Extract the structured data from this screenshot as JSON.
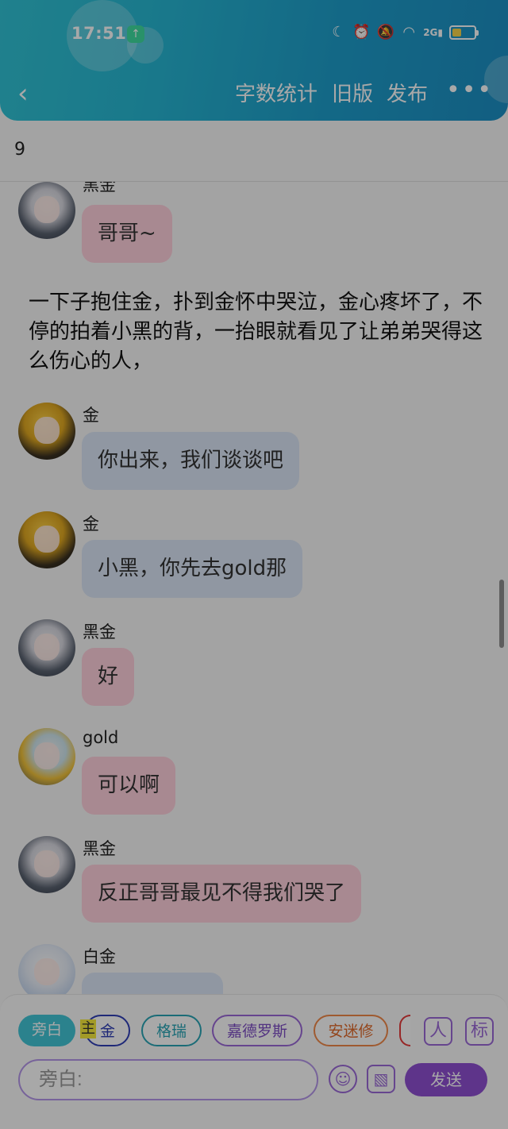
{
  "status_bar": {
    "time": "17:51",
    "upload_badge": "↑",
    "network": "2G"
  },
  "toolbar": {
    "back": "‹",
    "word_count": "字数统计",
    "old_version": "旧版",
    "publish": "发布",
    "more": "•••"
  },
  "chapter_count": "9",
  "messages": [
    {
      "type": "chat",
      "name": "黑金",
      "text": "哥哥~",
      "avatar": "heijin",
      "bubble": "pink"
    },
    {
      "type": "narration",
      "text": "一下子抱住金，扑到金怀中哭泣，金心疼坏了，不停的拍着小黑的背，一抬眼就看见了让弟弟哭得这么伤心的人，"
    },
    {
      "type": "chat",
      "name": "金",
      "text": "你出来，我们谈谈吧",
      "avatar": "jin",
      "bubble": "blue"
    },
    {
      "type": "chat",
      "name": "金",
      "text": "小黑，你先去gold那",
      "avatar": "jin",
      "bubble": "blue"
    },
    {
      "type": "chat",
      "name": "黑金",
      "text": "好",
      "avatar": "heijin",
      "bubble": "pink"
    },
    {
      "type": "chat",
      "name": "gold",
      "text": "可以啊",
      "avatar": "gold",
      "bubble": "pink"
    },
    {
      "type": "chat",
      "name": "黑金",
      "text": "反正哥哥最见不得我们哭了",
      "avatar": "heijin",
      "bubble": "pink"
    },
    {
      "type": "chat",
      "name": "白金",
      "text": "",
      "avatar": "baijin",
      "bubble": "blue"
    }
  ],
  "roles": {
    "narration": "旁白",
    "main_tag": "主",
    "items": [
      "金",
      "格瑞",
      "嘉德罗斯",
      "安迷修"
    ],
    "contacts_icon": "人",
    "tag_button": "标"
  },
  "input": {
    "placeholder": "旁白:",
    "emoji_icon": "☺",
    "image_icon": "▧",
    "send": "发送"
  },
  "colors": {
    "header_start": "#31c4d6",
    "header_end": "#1c8fc4",
    "pink_bubble": "#ffd0dc",
    "blue_bubble": "#dbe6f6",
    "accent_purple": "#8f4fd2"
  }
}
